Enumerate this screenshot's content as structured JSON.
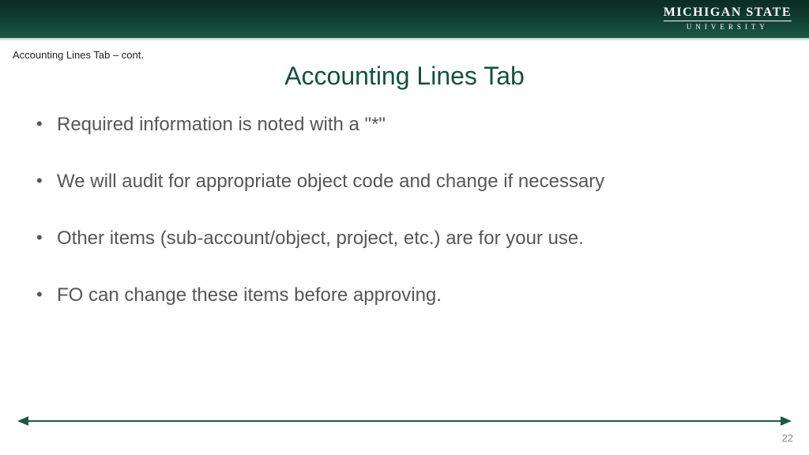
{
  "header": {
    "logo_main": "MICHIGAN STATE",
    "logo_sub": "UNIVERSITY"
  },
  "breadcrumb": "Accounting Lines Tab – cont.",
  "title": "Accounting Lines Tab",
  "bullets": [
    "Required information is noted with a \"*\"",
    "We will audit for appropriate object code and change if necessary",
    "Other items (sub-account/object, project, etc.) are for your use.",
    "FO can change these items before approving."
  ],
  "page_number": "22"
}
